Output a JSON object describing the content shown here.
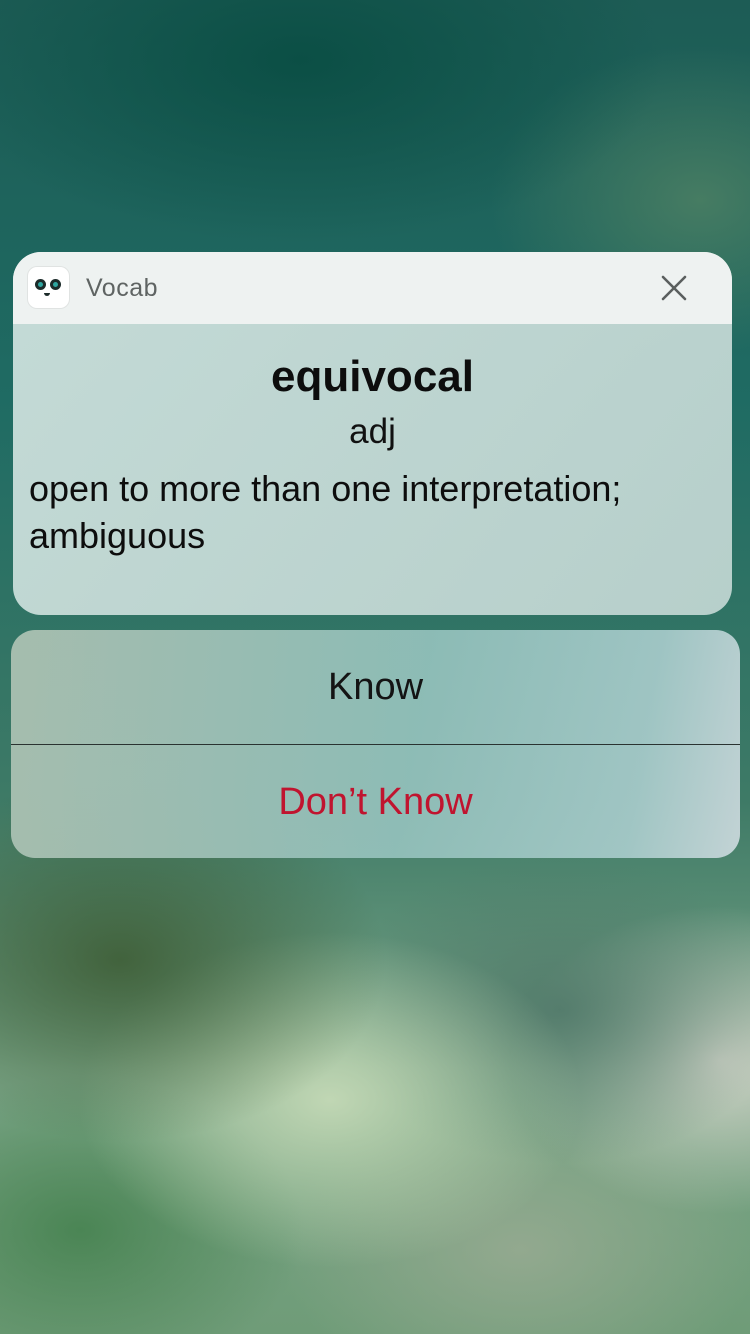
{
  "notification": {
    "app_name": "Vocab",
    "app_icon": "panda-face-icon",
    "close_icon": "close-icon",
    "word": "equivocal",
    "part_of_speech": "adj",
    "definition": "open to more than one interpretation; ambiguous"
  },
  "actions": {
    "know_label": "Know",
    "dont_know_label": "Don’t Know",
    "dont_know_color": "#c0142f"
  }
}
